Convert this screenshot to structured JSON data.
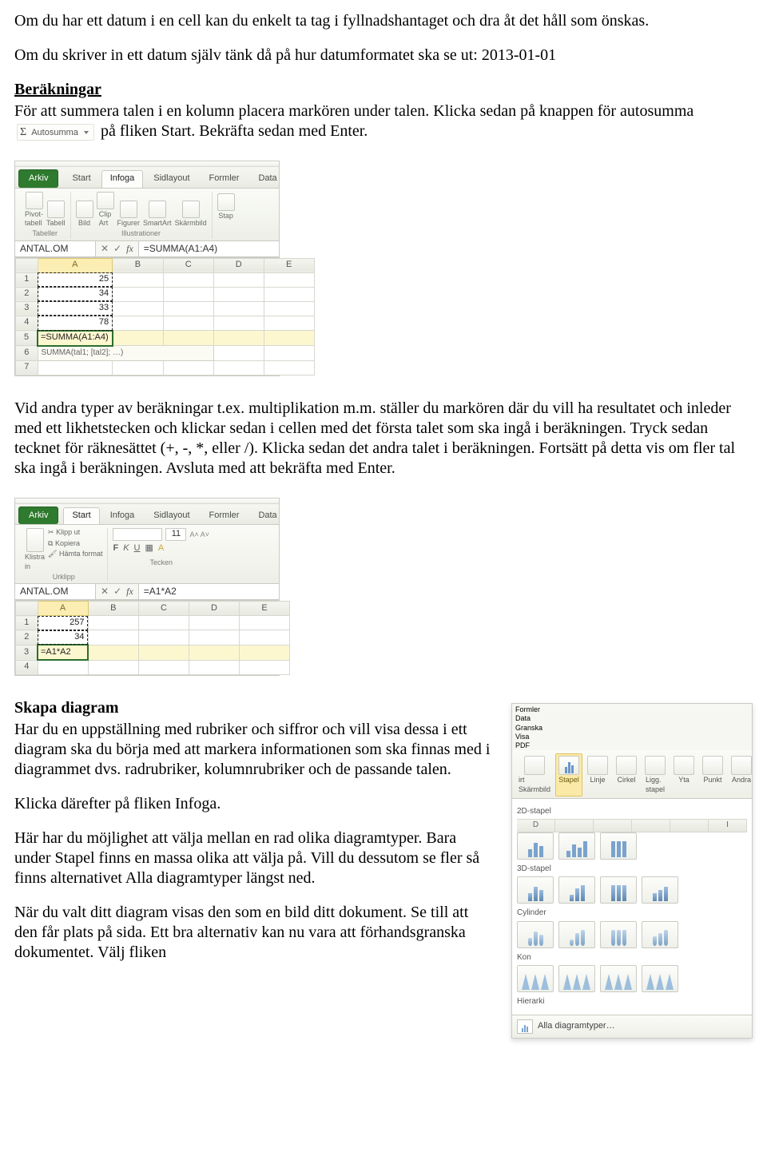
{
  "para1": "Om du har ett datum i en cell kan du enkelt ta tag i fyllnadshantaget och dra åt det håll som önskas.",
  "para2": "Om du skriver in ett datum själv tänk då på hur datumformatet ska se ut: 2013-01-01",
  "h_berakningar": "Beräkningar",
  "para3a": "För att summera talen i en kolumn placera markören under talen. Klicka sedan på knappen för autosumma ",
  "autosumma_label": "Autosumma",
  "para3b": " på fliken Start. Bekräfta sedan med Enter.",
  "excel1": {
    "tabs": {
      "file": "Arkiv",
      "t1": "Start",
      "t2": "Infoga",
      "t3": "Sidlayout",
      "t4": "Formler",
      "t5": "Data"
    },
    "groups": {
      "g1": {
        "items": [
          "Pivot-\ntabell",
          "Tabell"
        ],
        "label": "Tabeller"
      },
      "g2": {
        "items": [
          "Bild",
          "Clip\nArt",
          "Figurer",
          "SmartArt",
          "Skärmbild"
        ],
        "label": "Illustrationer"
      },
      "g3": {
        "items": [
          "Stap"
        ],
        "label": ""
      }
    },
    "namebox": "ANTAL.OM",
    "fx": "=SUMMA(A1:A4)",
    "cols": [
      "A",
      "B",
      "C",
      "D",
      "E"
    ],
    "rows": [
      {
        "n": "1",
        "a": "25"
      },
      {
        "n": "2",
        "a": "34"
      },
      {
        "n": "3",
        "a": "33"
      },
      {
        "n": "4",
        "a": "78"
      },
      {
        "n": "5",
        "a": "=SUMMA(A1:A4)",
        "editing": true
      },
      {
        "n": "6",
        "hint": "SUMMA(tal1; [tal2]; …)"
      },
      {
        "n": "7",
        "a": ""
      }
    ]
  },
  "para4": "Vid andra typer av beräkningar t.ex. multiplikation m.m. ställer du markören där du vill ha resultatet och inleder med ett likhetstecken och klickar sedan i cellen med det första talet som ska ingå i beräkningen. Tryck sedan tecknet för räknesättet (+, -, *, eller /). Klicka sedan det andra talet i beräkningen. Fortsätt på detta vis om fler tal ska ingå i beräkningen. Avsluta med att bekräfta med Enter.",
  "excel2": {
    "tabs": {
      "file": "Arkiv",
      "t1": "Start",
      "t2": "Infoga",
      "t3": "Sidlayout",
      "t4": "Formler",
      "t5": "Data"
    },
    "groups": {
      "g1": {
        "items": [
          "Klistra\nin"
        ],
        "sub": [
          "Klipp ut",
          "Kopiera",
          "Hämta format"
        ],
        "label": "Urklipp"
      },
      "g2": {
        "font": "11",
        "label": "Tecken"
      }
    },
    "namebox": "ANTAL.OM",
    "fx": "=A1*A2",
    "cols": [
      "A",
      "B",
      "C",
      "D",
      "E"
    ],
    "rows": [
      {
        "n": "1",
        "a": "257"
      },
      {
        "n": "2",
        "a": "34"
      },
      {
        "n": "3",
        "a": "=A1*A2",
        "editing": true
      },
      {
        "n": "4",
        "a": ""
      }
    ]
  },
  "h_diagram": "Skapa diagram",
  "para5": "Har du en uppställning med rubriker och siffror och vill visa dessa i ett diagram ska du börja med att markera informationen som ska finnas med i diagrammet dvs. radrubriker, kolumnrubriker och de passande talen.",
  "para6": "Klicka därefter på fliken Infoga.",
  "para7": "Här har du möjlighet att välja mellan en rad olika diagramtyper. Bara under Stapel finns en massa olika att välja på. Vill du dessutom se fler så finns alternativet Alla diagramtyper längst ned.",
  "para8": "När du valt ditt diagram visas den som en bild ditt dokument. Se till att den får plats på sida. Ett bra alternativ kan nu vara att förhandsgranska dokumentet. Välj fliken",
  "chartpop": {
    "ribbonTabs": [
      "Formler",
      "Data",
      "Granska",
      "Visa",
      "PDF"
    ],
    "ribbonItems": [
      {
        "l": "irt Skärmbild"
      },
      {
        "l": "Stapel",
        "sel": true
      },
      {
        "l": "Linje"
      },
      {
        "l": "Cirkel"
      },
      {
        "l": "Ligg.\nstapel"
      },
      {
        "l": "Yta"
      },
      {
        "l": "Punkt"
      },
      {
        "l": "Andra"
      }
    ],
    "hdrcols": [
      "D",
      "",
      "",
      "",
      "",
      "I"
    ],
    "sections": [
      "2D-stapel",
      "3D-stapel",
      "Cylinder",
      "Kon",
      "Hierarki"
    ],
    "footer": "Alla diagramtyper…"
  }
}
